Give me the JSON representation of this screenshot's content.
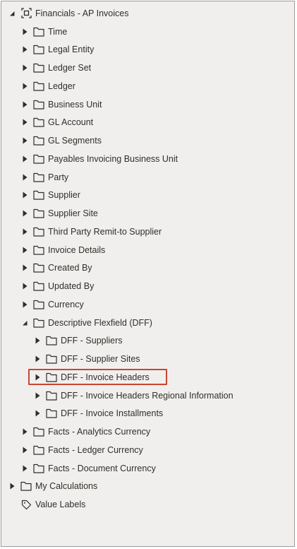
{
  "root": {
    "label": "Financials - AP Invoices",
    "icon": "subject-area-icon",
    "expanded": true
  },
  "items": [
    {
      "label": "Time"
    },
    {
      "label": "Legal Entity"
    },
    {
      "label": "Ledger Set"
    },
    {
      "label": "Ledger"
    },
    {
      "label": "Business Unit"
    },
    {
      "label": "GL Account"
    },
    {
      "label": "GL Segments"
    },
    {
      "label": "Payables Invoicing Business Unit"
    },
    {
      "label": "Party"
    },
    {
      "label": "Supplier"
    },
    {
      "label": "Supplier Site"
    },
    {
      "label": "Third Party Remit-to Supplier"
    },
    {
      "label": "Invoice Details"
    },
    {
      "label": "Created By"
    },
    {
      "label": "Updated By"
    },
    {
      "label": "Currency"
    },
    {
      "label": "Descriptive Flexfield (DFF)",
      "expanded": true
    }
  ],
  "dff_children": [
    {
      "label": "DFF - Suppliers"
    },
    {
      "label": "DFF - Supplier Sites"
    },
    {
      "label": "DFF - Invoice Headers",
      "highlighted": true
    },
    {
      "label": "DFF - Invoice Headers Regional Information"
    },
    {
      "label": "DFF - Invoice Installments"
    }
  ],
  "facts": [
    {
      "label": "Facts - Analytics Currency"
    },
    {
      "label": "Facts - Ledger Currency"
    },
    {
      "label": "Facts - Document Currency"
    }
  ],
  "top_level": [
    {
      "label": "My Calculations",
      "icon": "folder-icon"
    },
    {
      "label": "Value Labels",
      "icon": "tag-icon"
    }
  ],
  "colors": {
    "panel_bg": "#f1efed",
    "text": "#312d2a",
    "highlight_border": "#c74634"
  }
}
